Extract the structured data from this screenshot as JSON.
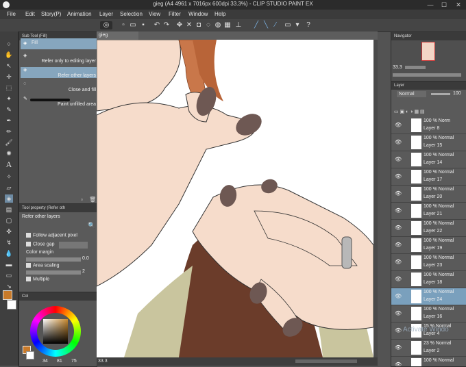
{
  "window": {
    "title": "gieg (A4 4961 x 7016px 600dpi 33.3%) - CLIP STUDIO PAINT EX",
    "minimize": "—",
    "maximize": "☐",
    "close": "✕"
  },
  "menu": [
    "File",
    "Edit",
    "Story(P)",
    "Animation",
    "Layer",
    "Selection",
    "View",
    "Filter",
    "Window",
    "Help"
  ],
  "subtool": {
    "header": "Sub Tool (Fill)",
    "items": [
      {
        "label": "Fill"
      },
      {
        "label": "Refer only to editing layer"
      },
      {
        "label": "Refer other layers"
      },
      {
        "label": "Close and fill"
      },
      {
        "label": "Paint unfilled area"
      }
    ]
  },
  "toolprop": {
    "header": "Tool property (Refer oth",
    "title": "Refer other layers",
    "follow_adjacent": "Follow adjacent pixel",
    "close_gap": "Close gap",
    "color_margin": "Color margin",
    "color_margin_value": "0.0",
    "area_scaling": "Area scaling",
    "area_scaling_value": "2",
    "multiple": "Multiple"
  },
  "color": {
    "tab": "Col",
    "main": "#c87a2a",
    "sub": "#ffffff",
    "picked": "#c98a30",
    "values": [
      "34",
      "81",
      "75"
    ]
  },
  "canvas": {
    "tab": "gieg",
    "zoom": "33.3"
  },
  "navigator": {
    "header": "Navigator",
    "zoom": "33.3"
  },
  "layers": {
    "header": "Layer",
    "blend_mode": "Normal",
    "opacity": "100",
    "rows": [
      {
        "mode": "100 % Norm",
        "name": "Layer 8"
      },
      {
        "mode": "100 % Normal",
        "name": "Layer 15"
      },
      {
        "mode": "100 % Normal",
        "name": "Layer 14"
      },
      {
        "mode": "100 % Normal",
        "name": "Layer 17"
      },
      {
        "mode": "100 % Normal",
        "name": "Layer 20"
      },
      {
        "mode": "100 % Normal",
        "name": "Layer 21"
      },
      {
        "mode": "100 % Normal",
        "name": "Layer 22"
      },
      {
        "mode": "100 % Normal",
        "name": "Layer 19"
      },
      {
        "mode": "100 % Normal",
        "name": "Layer 23"
      },
      {
        "mode": "100 % Normal",
        "name": "Layer 18"
      },
      {
        "mode": "100 % Normal",
        "name": "Layer 24"
      },
      {
        "mode": "100 % Normal",
        "name": "Layer 16"
      },
      {
        "mode": "15 % Normal",
        "name": "Layer 4"
      },
      {
        "mode": "23 % Normal",
        "name": "Layer 2"
      },
      {
        "mode": "100 % Normal",
        "name": ""
      }
    ],
    "selected_index": 10
  },
  "watermark": "Activate Windo"
}
